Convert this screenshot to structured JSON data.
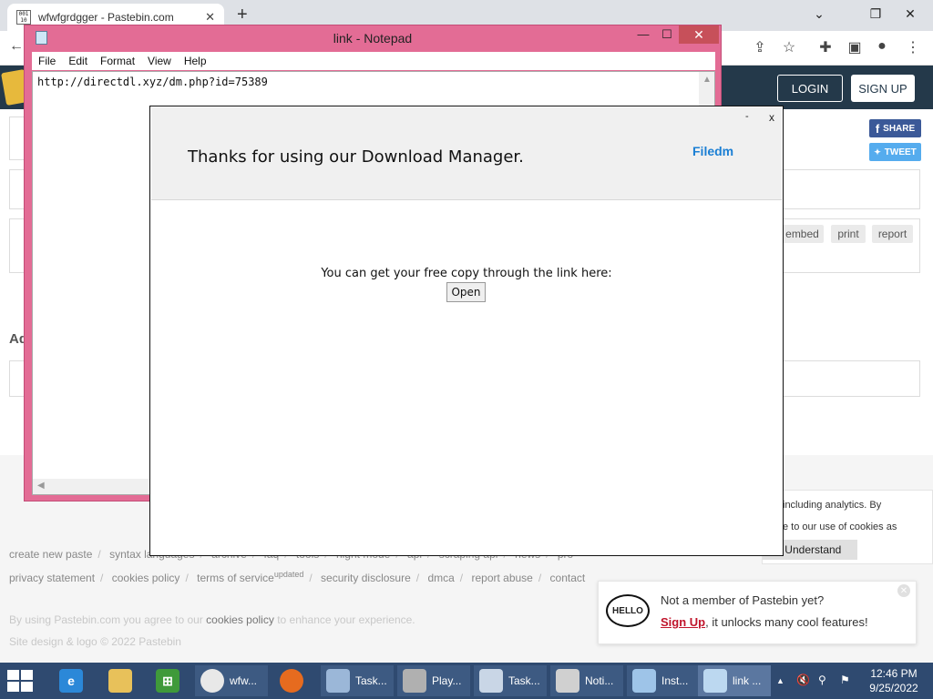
{
  "browser": {
    "tab_title": "wfwfgrdgger - Pastebin.com",
    "tab_favicon_text": "001 10",
    "tab_close": "✕",
    "new_tab": "+",
    "minimize": "⌄",
    "restore": "❐",
    "close": "✕"
  },
  "pastebin": {
    "login_label": "LOGIN",
    "signup_label": "SIGN UP",
    "share_label": "SHARE",
    "tweet_label": "TWEET",
    "actions": [
      "embed",
      "print",
      "report"
    ],
    "heading_fragment": "Ad",
    "footer_row1": [
      "create new paste",
      "syntax languages",
      "archive",
      "faq",
      "tools",
      "night mode",
      "api",
      "scraping api",
      "news",
      "pro"
    ],
    "footer_row2": [
      "privacy statement",
      "cookies policy",
      "terms of service",
      "security disclosure",
      "dmca",
      "report abuse",
      "contact"
    ],
    "terms_superscript": "updated",
    "footer_note_prefix": "By using Pastebin.com you agree to our",
    "footer_note_link": "cookies policy",
    "footer_note_suffix": "to enhance your experience.",
    "copyright": "Site design & logo © 2022 Pastebin",
    "cookie_line1": "including analytics. By",
    "cookie_line2": "e to our use of cookies as",
    "cookie_button": "I Understand",
    "promo_bubble": "HELLO",
    "promo_line1": "Not a member of Pastebin yet?",
    "promo_signup": "Sign Up",
    "promo_line2_suffix": ", it unlocks many cool features!",
    "promo_close": "✕"
  },
  "notepad": {
    "title": "link - Notepad",
    "minimize": "—",
    "maximize": "☐",
    "close": "✕",
    "menu": [
      "File",
      "Edit",
      "Format",
      "View",
      "Help"
    ],
    "content": "http://directdl.xyz/dm.php?id=75389"
  },
  "dialog": {
    "minimize": "-",
    "close": "x",
    "heading": "Thanks for using our Download Manager.",
    "brand": "Filedm",
    "message": "You can get your free copy through the link here:",
    "open_button": "Open"
  },
  "taskbar": {
    "items": [
      {
        "label": "wfw...",
        "icon": "chrome-icon",
        "color": "#e8e8e8"
      },
      {
        "label": "Task...",
        "icon": "task-manager-icon",
        "color": "#9bb7d8"
      },
      {
        "label": "Play...",
        "icon": "media-player-icon",
        "color": "#b0b0b0"
      },
      {
        "label": "Task...",
        "icon": "task-scheduler-icon",
        "color": "#c9d6e6"
      },
      {
        "label": "Noti...",
        "icon": "notification-icon",
        "color": "#d0d0d0"
      },
      {
        "label": "Inst...",
        "icon": "installer-icon",
        "color": "#9ec4e8"
      },
      {
        "label": "link ...",
        "icon": "notepad-icon",
        "color": "#bcd8f0"
      }
    ],
    "time": "12:46 PM",
    "date": "9/25/2022"
  }
}
